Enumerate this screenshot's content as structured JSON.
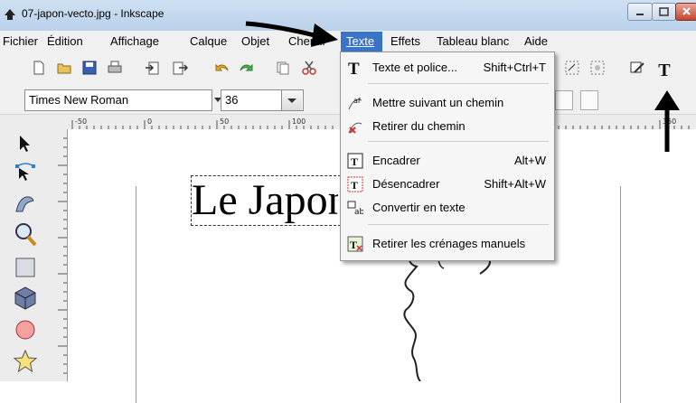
{
  "window": {
    "title": "07-japon-vecto.jpg - Inkscape"
  },
  "menubar": {
    "items": [
      "Fichier",
      "Édition",
      "Affichage",
      "Calque",
      "Objet",
      "Chemin",
      "Texte",
      "Effets",
      "Tableau blanc",
      "Aide"
    ]
  },
  "fontbar": {
    "font_family": "Times New Roman",
    "font_size": "36"
  },
  "ruler": {
    "labels": [
      "-50",
      "0",
      "50",
      "100",
      "350"
    ]
  },
  "canvas": {
    "text": "Le Japon"
  },
  "texte_menu": {
    "items": [
      {
        "label": "Texte et police...",
        "shortcut": "Shift+Ctrl+T"
      },
      {
        "label": "Mettre suivant un chemin",
        "shortcut": ""
      },
      {
        "label": "Retirer du chemin",
        "shortcut": ""
      },
      {
        "label": "Encadrer",
        "shortcut": "Alt+W"
      },
      {
        "label": "Désencadrer",
        "shortcut": "Shift+Alt+W"
      },
      {
        "label": "Convertir en texte",
        "shortcut": ""
      },
      {
        "label": "Retirer les crénages manuels",
        "shortcut": ""
      }
    ]
  },
  "colors": {
    "menu_highlight": "#3a74c9",
    "annotation_arrow": "#000000"
  }
}
